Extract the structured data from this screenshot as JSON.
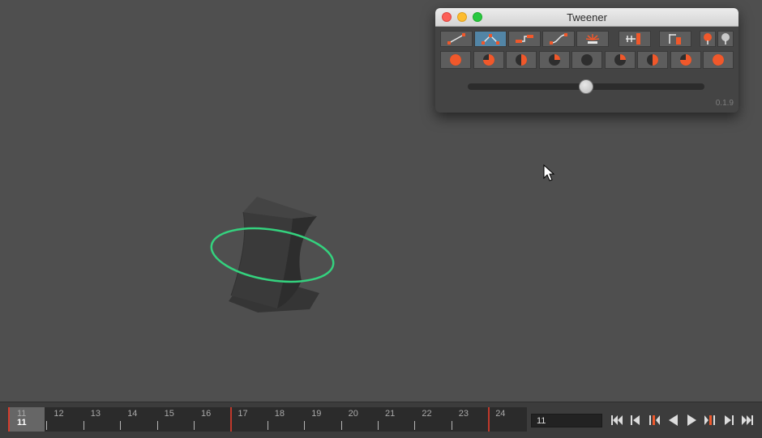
{
  "tweener": {
    "title": "Tweener",
    "version": "0.1.9",
    "tween_buttons": [
      {
        "icon": "linear-tween-icon",
        "active": false
      },
      {
        "icon": "overshoot-tween-icon",
        "active": true
      },
      {
        "icon": "stepped-tween-icon",
        "active": false
      },
      {
        "icon": "ease-curve-tween-icon",
        "active": false
      },
      {
        "icon": "burst-tween-icon",
        "active": false
      },
      {
        "icon": "insert-key-icon",
        "active": false
      },
      {
        "icon": "overwrite-key-icon",
        "active": false
      },
      {
        "icon": "pin-orange-icon",
        "active": false
      },
      {
        "icon": "pin-gray-icon",
        "active": false
      }
    ],
    "preset_fractions": [
      1,
      0.75,
      0.5,
      0.25,
      0,
      0.25,
      0.5,
      0.75,
      1
    ],
    "slider_value": 0.5,
    "accent_color": "#f0582b",
    "active_color": "#5285a6"
  },
  "timeline": {
    "tick_labels": [
      "11",
      "12",
      "13",
      "14",
      "15",
      "16",
      "17",
      "18",
      "19",
      "20",
      "21",
      "22",
      "23",
      "24"
    ],
    "current_frame": "11",
    "key_frames": [
      11,
      17,
      24
    ],
    "frame_field_value": "11",
    "playback_icons": [
      "go-to-start-icon",
      "step-back-key-icon",
      "prev-key-icon",
      "play-backward-icon",
      "play-forward-icon",
      "next-key-icon",
      "step-forward-key-icon",
      "go-to-end-icon"
    ],
    "key_color": "#c0392b"
  },
  "scene": {
    "ring_color": "#34d27e",
    "object": "twisted-box"
  }
}
